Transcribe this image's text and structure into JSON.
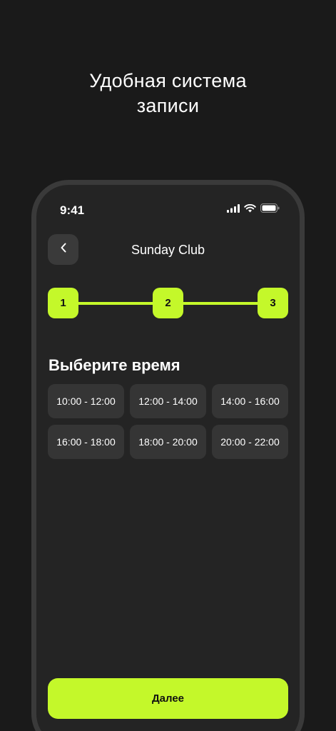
{
  "headline": "Удобная система\nзаписи",
  "status_bar": {
    "time": "9:41",
    "icons": [
      "cellular-signal-icon",
      "wifi-icon",
      "battery-icon"
    ]
  },
  "header": {
    "back_icon": "chevron-left-icon",
    "title": "Sunday Club"
  },
  "stepper": {
    "steps": [
      "1",
      "2",
      "3"
    ],
    "accent_color": "#c4f82a"
  },
  "section_title": "Выберите время",
  "time_slots": [
    "10:00 - 12:00",
    "12:00 - 14:00",
    "14:00 - 16:00",
    "16:00 - 18:00",
    "18:00 - 20:00",
    "20:00 - 22:00"
  ],
  "next_button_label": "Далее",
  "colors": {
    "background": "#1a1a1a",
    "screen": "#242424",
    "accent": "#c4f82a",
    "slot": "#353535"
  }
}
